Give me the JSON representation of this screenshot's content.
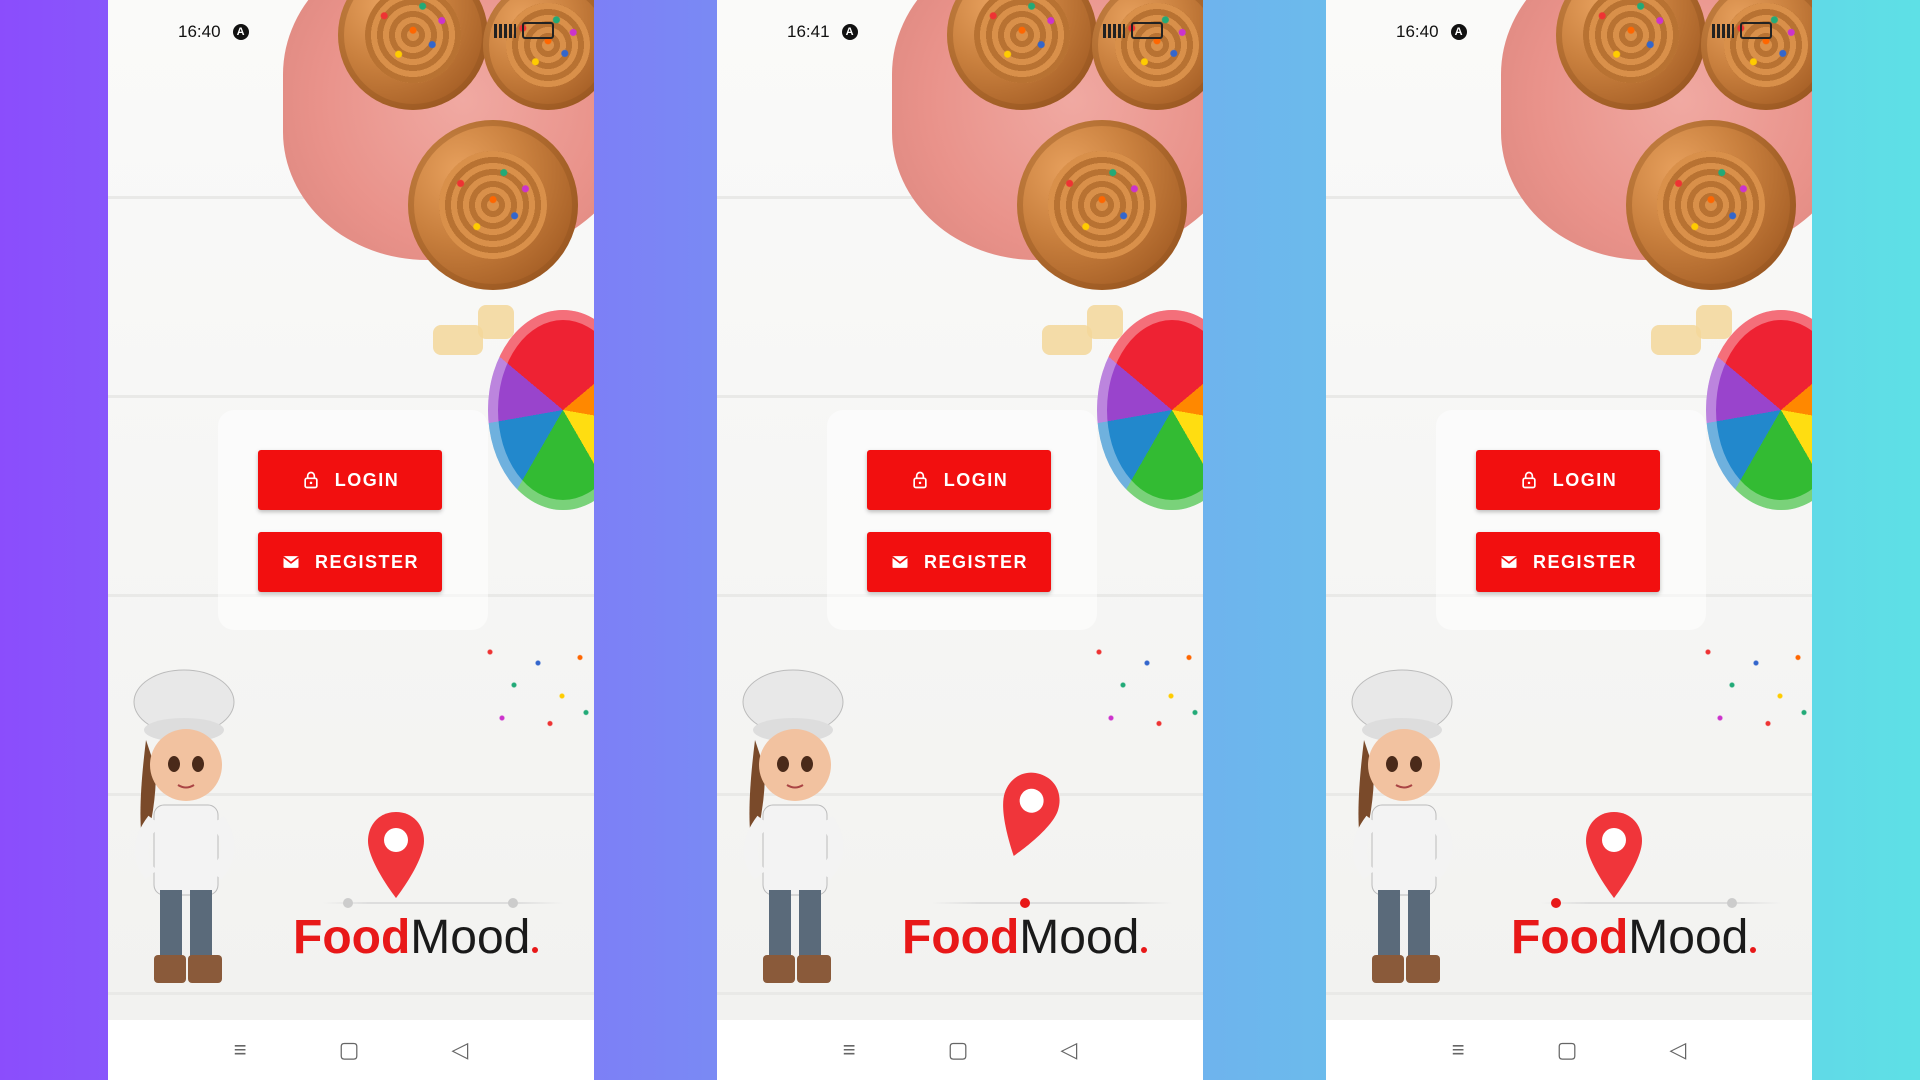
{
  "app": {
    "name_part1": "Food",
    "name_part2": "Mood"
  },
  "colors": {
    "brand": "#f20f0f",
    "bg_left": "#8b4dfc",
    "bg_right": "#5ee0e6"
  },
  "phones": [
    {
      "time": "16:40",
      "login_label": "LOGIN",
      "register_label": "REGISTER"
    },
    {
      "time": "16:41",
      "login_label": "LOGIN",
      "register_label": "REGISTER"
    },
    {
      "time": "16:40",
      "login_label": "LOGIN",
      "register_label": "REGISTER"
    }
  ],
  "navbar": {
    "menu_icon": "≡",
    "home_icon": "▢",
    "back_icon": "◁"
  }
}
